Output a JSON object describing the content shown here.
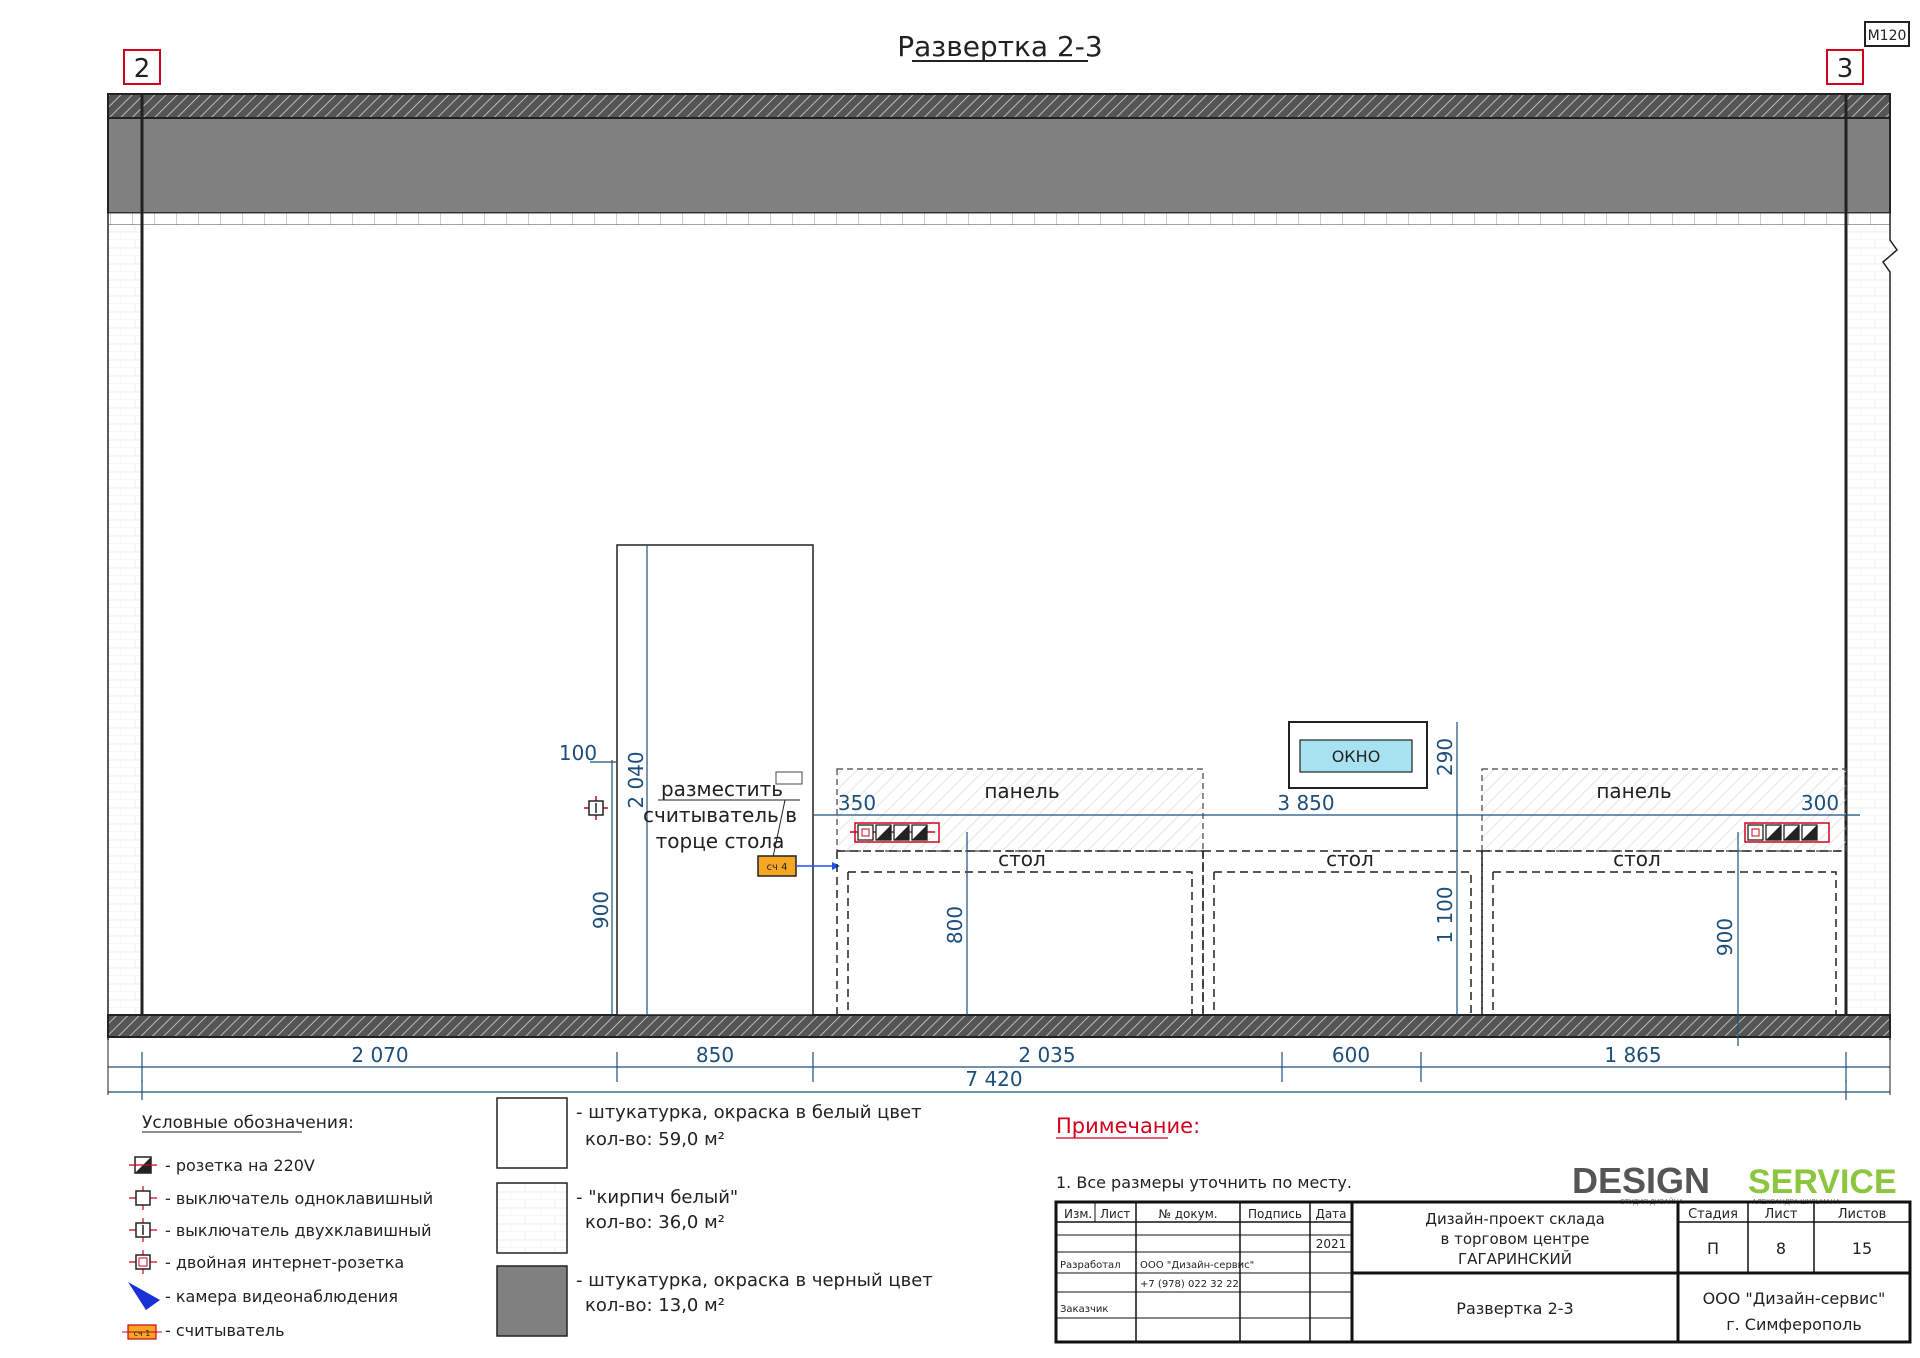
{
  "title": "Развертка 2-3",
  "scale": "М120",
  "axes": {
    "left": "2",
    "right": "3"
  },
  "door": {
    "dim_height": "2 040",
    "dim_offset": "100"
  },
  "note_reader": {
    "line1": "разместить",
    "line2": "считыватель в",
    "line3": "торце стола"
  },
  "reader_label": "сч 4",
  "window_label": "ОКНО",
  "panel_label": "панель",
  "table_label": "стол",
  "dims": {
    "d350": "350",
    "d3850": "3 850",
    "d300": "300",
    "d290": "290",
    "d900a": "900",
    "d800": "800",
    "d1100": "1 100",
    "d900b": "900",
    "b2070": "2 070",
    "b850": "850",
    "b2035": "2 035",
    "b600": "600",
    "b1865": "1 865",
    "total": "7 420"
  },
  "legend": {
    "heading": "Условные обозначения:",
    "items": [
      "- розетка на 220V",
      "- выключатель одноклавишный",
      "- выключатель двухклавишный",
      "- двойная интернет-розетка",
      "- камера видеонаблюдения",
      "- считыватель"
    ],
    "reader_icon_label": "сч 1"
  },
  "materials": [
    {
      "line1": "- штукатурка, окраска в белый цвет",
      "line2": "кол-во: 59,0 м²"
    },
    {
      "line1": "- \"кирпич белый\"",
      "line2": "кол-во: 36,0 м²"
    },
    {
      "line1": "- штукатурка, окраска в черный цвет",
      "line2": "кол-во: 13,0 м²"
    }
  ],
  "note": {
    "heading": "Примечание:",
    "line1": "1. Все размеры уточнить по месту."
  },
  "logo": {
    "word1": "DESIGN",
    "word2": "SERVICE",
    "sub1": "СТУДИЯ ДИЗАЙНА",
    "sub2": "АЛЕКСАНДРА ШУЛЬМАНА"
  },
  "title_block": {
    "h_izm": "Изм.",
    "h_list": "Лист",
    "h_doc": "№ докум.",
    "h_sign": "Подпись",
    "h_date": "Дата",
    "date": "2021",
    "developed": "Разработал",
    "developer": "ООО \"Дизайн-сервис\"",
    "phone": "+7 (978) 022 32 22",
    "customer": "Заказчик",
    "project1": "Дизайн-проект склада",
    "project2": "в торговом центре",
    "project3": "ГАГАРИНСКИЙ",
    "sheet_title": "Развертка 2-3",
    "h_stage": "Стадия",
    "h_sheet": "Лист",
    "h_sheets": "Листов",
    "stage": "П",
    "sheet": "8",
    "sheets": "15",
    "company": "ООО \"Дизайн-сервис\"",
    "city": "г. Симферополь"
  },
  "colors": {
    "wall_dark": "#808080",
    "accent_red": "#d0021b",
    "dim_blue": "#1d4f7a",
    "reader_orange": "#f5a623",
    "window_blue": "#a8e2f0",
    "logo_green": "#8cc63f"
  }
}
